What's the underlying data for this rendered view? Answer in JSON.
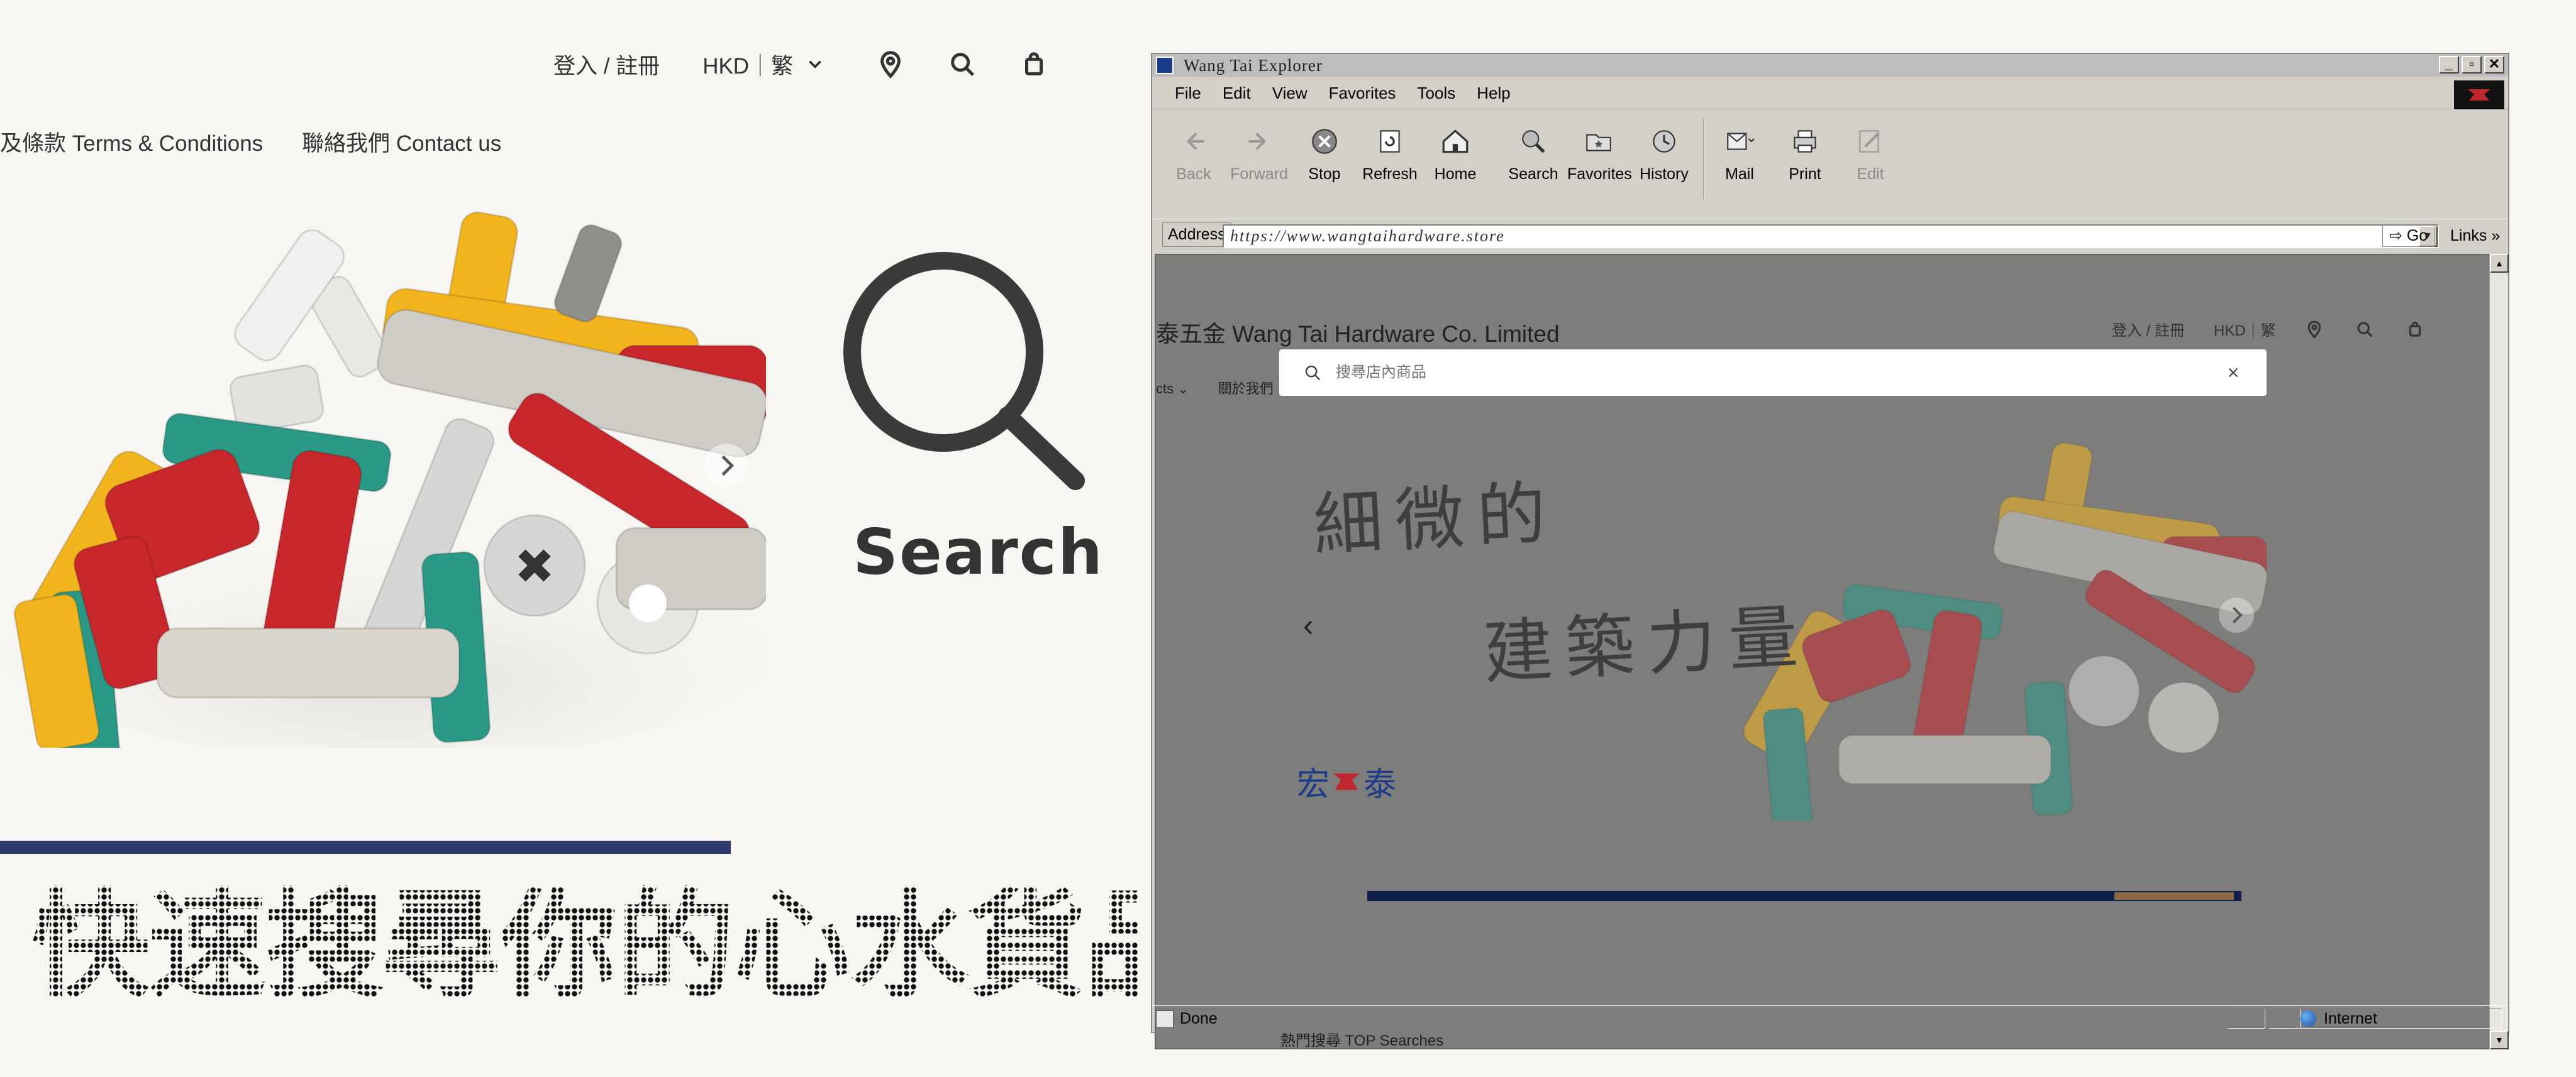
{
  "left": {
    "login": "登入 / 註冊",
    "currency": "HKD｜繁",
    "nav": [
      "及條款 Terms & Conditions",
      "聯絡我們 Contact us"
    ],
    "search_word": "Search",
    "dotted_title": "快速搜尋你的心水貨品"
  },
  "browser": {
    "title": "Wang Tai Explorer",
    "window_buttons": [
      "_",
      "▫",
      "✕"
    ],
    "menu": [
      "File",
      "Edit",
      "View",
      "Favorites",
      "Tools",
      "Help"
    ],
    "toolbar": [
      {
        "label": "Back",
        "icon": "back-arrow-icon",
        "enabled": false
      },
      {
        "label": "Forward",
        "icon": "forward-arrow-icon",
        "enabled": false
      },
      {
        "label": "Stop",
        "icon": "stop-icon",
        "enabled": true
      },
      {
        "label": "Refresh",
        "icon": "refresh-icon",
        "enabled": true
      },
      {
        "label": "Home",
        "icon": "home-icon",
        "enabled": true
      },
      {
        "label": "Search",
        "icon": "search-globe-icon",
        "enabled": true
      },
      {
        "label": "Favorites",
        "icon": "favorites-folder-icon",
        "enabled": true
      },
      {
        "label": "History",
        "icon": "history-icon",
        "enabled": true
      },
      {
        "label": "Mail",
        "icon": "mail-icon",
        "enabled": true
      },
      {
        "label": "Print",
        "icon": "print-icon",
        "enabled": true
      },
      {
        "label": "Edit",
        "icon": "edit-icon",
        "enabled": false
      }
    ],
    "address_label": "Address",
    "address_url": "https://www.wangtaihardware.store",
    "go_label": "Go",
    "links_label": "Links",
    "links_chevron": "»",
    "status_text": "Done",
    "zone_text": "Internet"
  },
  "site": {
    "name": "泰五金 Wang Tai Hardware Co. Limited",
    "login": "登入 / 註冊",
    "currency": "HKD｜繁",
    "nav": [
      "cts ⌄",
      "關於我們"
    ],
    "search_placeholder": "搜尋店內商品",
    "handwriting_line1": "細微的",
    "handwriting_line2": "建築力量",
    "logo_left": "宏",
    "logo_right": "泰",
    "top_searches": "熱門搜尋 TOP Searches"
  },
  "colors": {
    "page_bg": "#f7f6f3",
    "navy_bar": "#2e3a6c",
    "window_chrome": "#d4d0c8",
    "viewport_dim": "#7d7d7b",
    "logo_blue": "#1e3a8a",
    "logo_red": "#c0262d"
  }
}
